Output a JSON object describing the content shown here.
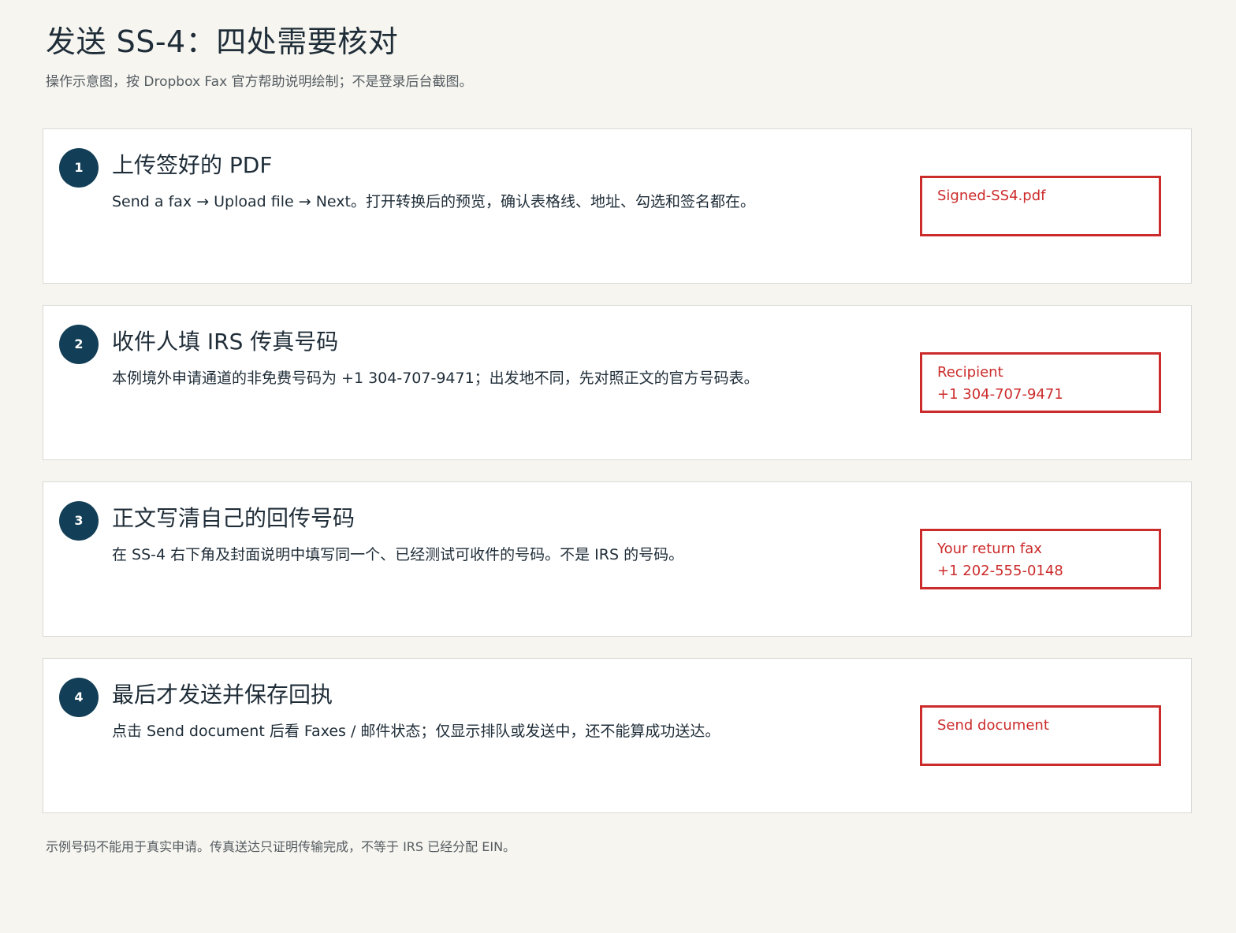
{
  "header": {
    "title": "发送 SS-4：四处需要核对",
    "subtitle": "操作示意图，按 Dropbox Fax 官方帮助说明绘制；不是登录后台截图。"
  },
  "steps": [
    {
      "number": "1",
      "title": "上传签好的 PDF",
      "description": "Send a fax → Upload file → Next。打开转换后的预览，确认表格线、地址、勾选和签名都在。",
      "field": {
        "line1": "Signed-SS4.pdf",
        "line2": ""
      }
    },
    {
      "number": "2",
      "title": "收件人填 IRS 传真号码",
      "description": "本例境外申请通道的非免费号码为 +1 304-707-9471；出发地不同，先对照正文的官方号码表。",
      "field": {
        "line1": "Recipient",
        "line2": "+1 304-707-9471"
      }
    },
    {
      "number": "3",
      "title": "正文写清自己的回传号码",
      "description": "在 SS-4 右下角及封面说明中填写同一个、已经测试可收件的号码。不是 IRS 的号码。",
      "field": {
        "line1": "Your return fax",
        "line2": "+1 202-555-0148"
      }
    },
    {
      "number": "4",
      "title": "最后才发送并保存回执",
      "description": "点击 Send document 后看 Faxes / 邮件状态；仅显示排队或发送中，还不能算成功送达。",
      "field": {
        "line1": "Send document",
        "line2": ""
      }
    }
  ],
  "footer": {
    "note": "示例号码不能用于真实申请。传真送达只证明传输完成，不等于 IRS 已经分配 EIN。"
  },
  "colors": {
    "background": "#f6f5f0",
    "step_badge": "#123f57",
    "highlight_red": "#cc2b2b"
  }
}
